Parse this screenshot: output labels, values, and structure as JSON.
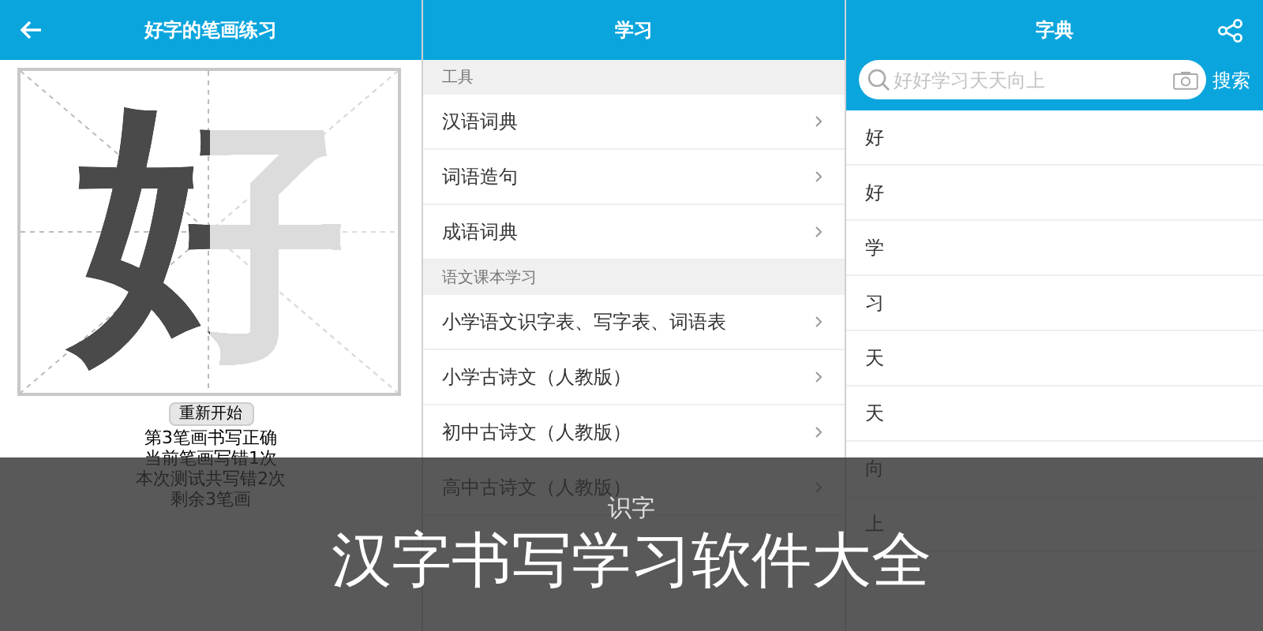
{
  "practice": {
    "title": "好字的笔画练习",
    "character": "好",
    "level": 0.5,
    "restart_button": "重新开始",
    "messages": [
      "第3笔画书写正确",
      "当前笔画写错1次",
      "本次测试共写错2次",
      "剩余3笔画"
    ]
  },
  "study": {
    "title": "学习",
    "sections": [
      {
        "header": "工具",
        "items": [
          "汉语词典",
          "词语造句",
          "成语词典"
        ]
      },
      {
        "header": "语文课本学习",
        "items": [
          "小学语文识字表、写字表、词语表",
          "小学古诗文（人教版）",
          "初中古诗文（人教版）",
          "高中古诗文（人教版）"
        ]
      }
    ]
  },
  "dictionary": {
    "title": "字典",
    "search": {
      "placeholder": "好好学习天天向上"
    },
    "search_button": "搜索",
    "results": [
      "好",
      "好",
      "学",
      "习",
      "天",
      "天",
      "向",
      "上"
    ]
  },
  "banner": {
    "caption": "识字",
    "title": "汉字书写学习软件大全"
  }
}
